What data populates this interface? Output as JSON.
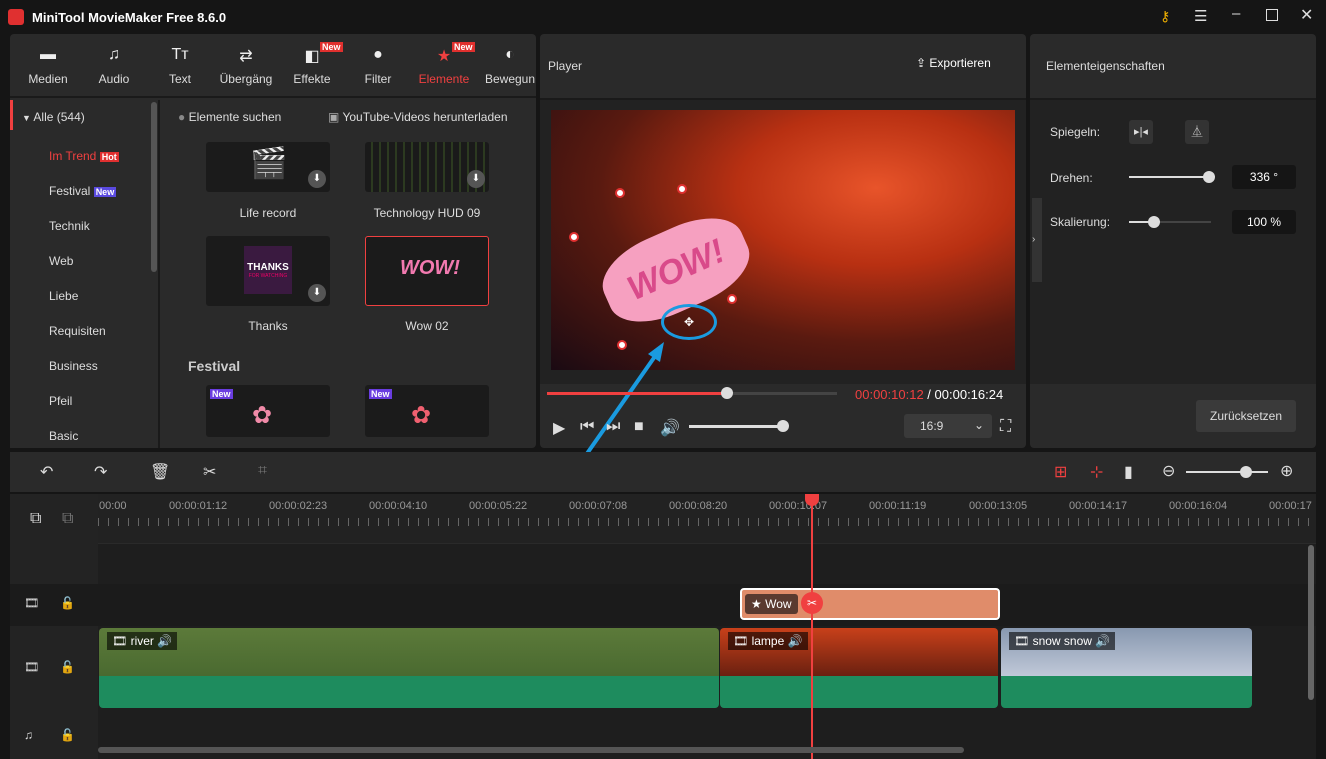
{
  "app": {
    "title": "MiniTool MovieMaker Free 8.6.0"
  },
  "tabs": [
    {
      "label": "Medien",
      "icon": "folder-icon"
    },
    {
      "label": "Audio",
      "icon": "music-icon"
    },
    {
      "label": "Text",
      "icon": "text-icon"
    },
    {
      "label": "Übergäng",
      "icon": "transition-icon"
    },
    {
      "label": "Effekte",
      "icon": "effects-icon",
      "badge": "New"
    },
    {
      "label": "Filter",
      "icon": "filter-icon"
    },
    {
      "label": "Elemente",
      "icon": "elements-icon",
      "badge": "New",
      "active": true
    },
    {
      "label": "Bewegun",
      "icon": "motion-icon"
    }
  ],
  "sidebar": {
    "all": "Alle (544)",
    "items": [
      {
        "label": "Im Trend",
        "badge": "Hot"
      },
      {
        "label": "Festival",
        "badge": "New"
      },
      {
        "label": "Technik"
      },
      {
        "label": "Web"
      },
      {
        "label": "Liebe"
      },
      {
        "label": "Requisiten"
      },
      {
        "label": "Business"
      },
      {
        "label": "Pfeil"
      },
      {
        "label": "Basic"
      }
    ]
  },
  "library": {
    "search": "Elemente suchen",
    "youtube": "YouTube-Videos herunterladen",
    "items": [
      "Life record",
      "Technology HUD 09",
      "Thanks",
      "Wow 02"
    ],
    "thanks_text": "THANKS",
    "thanks_sub": "FOR WATCHING",
    "section": "Festival",
    "new_badge": "New",
    "wow_text": "WOW!"
  },
  "player": {
    "title": "Player",
    "export": "Exportieren",
    "current": "00:00:10:12",
    "total": "00:00:16:24",
    "separator": " / ",
    "progress": 0.62,
    "volume": 1.0,
    "aspect": "16:9",
    "overlay_text": "WOW!"
  },
  "props": {
    "title": "Elementeigenschaften",
    "mirror": "Spiegeln:",
    "rotate": "Drehen:",
    "rotate_value": "336 °",
    "rotate_level": 0.98,
    "scale": "Skalierung:",
    "scale_value": "100 %",
    "scale_level": 0.3,
    "reset": "Zurücksetzen"
  },
  "timeline": {
    "ruler": [
      "00:00",
      "00:00:01:12",
      "00:00:02:23",
      "00:00:04:10",
      "00:00:05:22",
      "00:00:07:08",
      "00:00:08:20",
      "00:00:10:07",
      "00:00:11:19",
      "00:00:13:05",
      "00:00:14:17",
      "00:00:16:04",
      "00:00:17"
    ],
    "element_clip": "Wow",
    "clips": [
      "river",
      "lampe",
      "snow snow"
    ]
  },
  "colors": {
    "accent": "#f04040",
    "clip_element": "#e08c6a",
    "audio_wave": "#1e8c5e",
    "annotation": "#1a9be0"
  }
}
